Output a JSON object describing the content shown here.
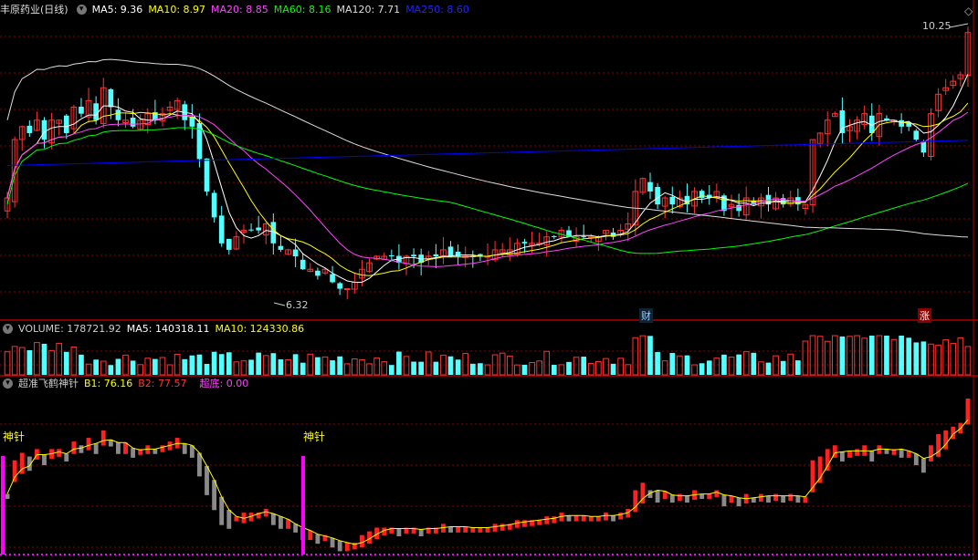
{
  "main_panel": {
    "stock_title": "丰原药业(日线)",
    "ma_legend": [
      {
        "label": "MA5: 9.36",
        "color": "#ffffff"
      },
      {
        "label": "MA10: 8.97",
        "color": "#ffff00"
      },
      {
        "label": "MA20: 8.85",
        "color": "#ff44ff"
      },
      {
        "label": "MA60: 8.16",
        "color": "#00ff00"
      },
      {
        "label": "MA120: 7.71",
        "color": "#dddddd"
      },
      {
        "label": "MA250: 8.60",
        "color": "#0000ff"
      }
    ],
    "high_label": "10.25",
    "low_label": "6.32",
    "badge_cai": "财",
    "badge_zhang": "涨",
    "diamond_icon": "diamond-icon"
  },
  "volume_panel": {
    "title": "VOLUME: 178721.92",
    "ma5": "MA5: 140318.11",
    "ma10": "MA10: 124330.86",
    "colors": {
      "title": "#cccccc",
      "ma5": "#ffffff",
      "ma10": "#ffff00"
    }
  },
  "indicator_panel": {
    "title": "超准飞鹤神针",
    "b1": "B1: 76.16",
    "b2": "B2: 77.57",
    "chaodi": "超底: 0.00",
    "signal_label_1": "神针",
    "signal_label_2": "神针",
    "colors": {
      "title": "#cccccc",
      "b1": "#ffff00",
      "b2": "#ff3333",
      "chaodi": "#ff44ff"
    }
  },
  "colors": {
    "up": "#ff3333",
    "down": "#54ffff",
    "grid": "#8b0000",
    "background": "#000000"
  },
  "chart_data": {
    "type": "candlestick",
    "price_axis_range": [
      5.9,
      10.5
    ],
    "closes": [
      7.7,
      8.6,
      8.8,
      8.7,
      8.9,
      8.6,
      8.9,
      8.9,
      8.7,
      9.1,
      9.0,
      9.2,
      8.9,
      9.4,
      9.1,
      8.9,
      8.9,
      8.8,
      8.9,
      9.0,
      8.9,
      9.0,
      9.1,
      9.2,
      8.9,
      8.8,
      8.3,
      7.8,
      7.4,
      7.0,
      6.9,
      7.1,
      7.2,
      7.2,
      7.2,
      7.3,
      7.0,
      6.9,
      6.9,
      6.8,
      6.6,
      6.6,
      6.5,
      6.6,
      6.4,
      6.3,
      6.3,
      6.4,
      6.6,
      6.7,
      6.8,
      6.8,
      6.8,
      6.7,
      6.8,
      6.8,
      6.7,
      6.8,
      6.8,
      6.9,
      6.8,
      6.8,
      6.8,
      6.8,
      6.8,
      6.8,
      6.9,
      6.9,
      6.9,
      7.0,
      7.0,
      7.0,
      7.0,
      7.1,
      7.1,
      7.2,
      7.1,
      7.1,
      7.1,
      7.1,
      7.1,
      7.2,
      7.1,
      7.2,
      7.3,
      7.8,
      8.0,
      7.8,
      7.6,
      7.7,
      7.6,
      7.7,
      7.6,
      7.8,
      7.7,
      7.7,
      7.8,
      7.5,
      7.6,
      7.5,
      7.7,
      7.6,
      7.7,
      7.6,
      7.7,
      7.6,
      7.7,
      7.6,
      7.6,
      8.6,
      8.7,
      8.9,
      9.0,
      8.7,
      8.8,
      8.9,
      9.0,
      8.7,
      9.0,
      8.9,
      8.9,
      8.8,
      8.8,
      8.6,
      8.4,
      9.0,
      9.3,
      9.4,
      9.5,
      9.6,
      10.25
    ],
    "indicator_axis_range": [
      0,
      100
    ],
    "b1_last": 76.16,
    "b2_last": 77.57,
    "chaodi_last": 0.0,
    "volume_last": 178721.92,
    "volume_ma5": 140318.11,
    "volume_ma10": 124330.86
  }
}
